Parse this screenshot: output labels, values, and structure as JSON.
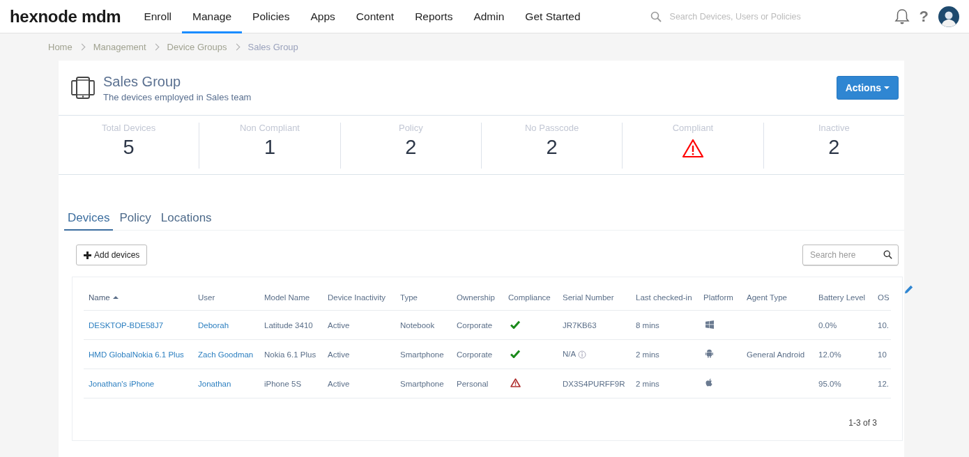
{
  "topbar": {
    "logo": "hexnode mdm",
    "menu": [
      {
        "label": "Enroll",
        "selected": false
      },
      {
        "label": "Manage",
        "selected": true
      },
      {
        "label": "Policies",
        "selected": false
      },
      {
        "label": "Apps",
        "selected": false
      },
      {
        "label": "Content",
        "selected": false
      },
      {
        "label": "Reports",
        "selected": false
      },
      {
        "label": "Admin",
        "selected": false
      },
      {
        "label": "Get Started",
        "selected": false
      }
    ],
    "search": {
      "placeholder": "Search Devices, Users or Policies"
    },
    "help": "?"
  },
  "breadcrumbs": [
    {
      "label": "Home",
      "current": false
    },
    {
      "label": "Management",
      "current": false
    },
    {
      "label": "Device Groups",
      "current": false
    },
    {
      "label": "Sales Group",
      "current": true
    }
  ],
  "group": {
    "title": "Sales Group",
    "subtitle": "The devices employed in Sales team",
    "actions_button": "Actions"
  },
  "stats": [
    {
      "label": "Total Devices",
      "kind": "number",
      "value": "5"
    },
    {
      "label": "Non Compliant",
      "kind": "number",
      "value": "1"
    },
    {
      "label": "Policy",
      "kind": "number",
      "value": "2"
    },
    {
      "label": "No Passcode",
      "kind": "number",
      "value": "2"
    },
    {
      "label": "Compliant",
      "kind": "warning"
    },
    {
      "label": "Inactive",
      "kind": "number",
      "value": "2"
    }
  ],
  "tabs": [
    {
      "label": "Devices",
      "selected": true
    },
    {
      "label": "Policy",
      "selected": false
    },
    {
      "label": "Locations",
      "selected": false
    }
  ],
  "add_button": "Add devices",
  "table_search": {
    "placeholder": "Search here"
  },
  "table": {
    "columns": [
      {
        "label": "Name",
        "sorted": true
      },
      {
        "label": "User",
        "sorted": false
      },
      {
        "label": "Model Name",
        "sorted": false
      },
      {
        "label": "Device Inactivity",
        "sorted": false
      },
      {
        "label": "Type",
        "sorted": false
      },
      {
        "label": "Ownership",
        "sorted": false
      },
      {
        "label": "Compliance",
        "sorted": false
      },
      {
        "label": "Serial Number",
        "sorted": false
      },
      {
        "label": "Last checked-in",
        "sorted": false
      },
      {
        "label": "Platform",
        "sorted": false
      },
      {
        "label": "Agent Type",
        "sorted": false
      },
      {
        "label": "Battery Level",
        "sorted": false
      },
      {
        "label": "OS",
        "sorted": false
      }
    ],
    "rows": [
      {
        "name": "DESKTOP-BDE58J7",
        "user": "Deborah",
        "model": "Latitude 3410",
        "inactivity": "Active",
        "type": "Notebook",
        "ownership": "Corporate",
        "compliance": {
          "kind": "compliant"
        },
        "serial": "JR7KB63",
        "serial_info": false,
        "last_checked_in": "8 mins",
        "platform": {
          "kind": "windows"
        },
        "battery": "0.0%",
        "os": "10."
      },
      {
        "name": "HMD GlobalNokia 6.1 Plus",
        "user": "Zach Goodman",
        "model": "Nokia 6.1 Plus",
        "inactivity": "Active",
        "type": "Smartphone",
        "ownership": "Corporate",
        "compliance": {
          "kind": "compliant"
        },
        "serial": "N/A",
        "serial_info": true,
        "last_checked_in": "2 mins",
        "platform": {
          "kind": "android"
        },
        "agent_type": "General Android",
        "battery": "12.0%",
        "os": "10"
      },
      {
        "name": "Jonathan's iPhone",
        "user": "Jonathan",
        "model": "iPhone 5S",
        "inactivity": "Active",
        "type": "Smartphone",
        "ownership": "Personal",
        "compliance": {
          "kind": "non_compliant"
        },
        "serial": "DX3S4PURFF9R",
        "serial_info": false,
        "last_checked_in": "2 mins",
        "platform": {
          "kind": "apple"
        },
        "battery": "95.0%",
        "os": "12."
      }
    ],
    "pagination": "1-3 of 3"
  }
}
